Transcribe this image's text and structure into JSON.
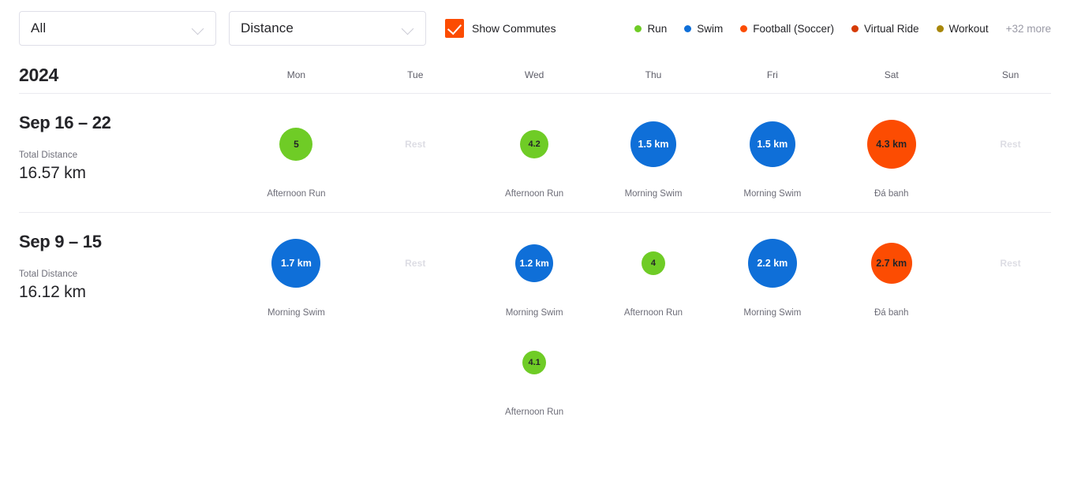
{
  "toolbar": {
    "sport_filter": {
      "value": "All",
      "chevron_icon": "chevron-down-icon"
    },
    "metric_filter": {
      "value": "Distance",
      "chevron_icon": "chevron-down-icon"
    },
    "show_commutes": {
      "label": "Show Commutes",
      "checked": true,
      "icon": "check-icon",
      "color": "#fc4c02"
    }
  },
  "legend": {
    "items": [
      {
        "label": "Run",
        "color": "#6fcc26"
      },
      {
        "label": "Swim",
        "color": "#0f6fd8"
      },
      {
        "label": "Football (Soccer)",
        "color": "#fc4c02"
      },
      {
        "label": "Virtual Ride",
        "color": "#d63b06"
      },
      {
        "label": "Workout",
        "color": "#a8870a"
      }
    ],
    "more": "+32 more"
  },
  "calendar": {
    "year": "2024",
    "weekdays": [
      "Mon",
      "Tue",
      "Wed",
      "Thu",
      "Fri",
      "Sat",
      "Sun"
    ],
    "rest_label": "Rest",
    "weeks": [
      {
        "range": "Sep 16 – 22",
        "total_label": "Total Distance",
        "total_value": "16.57 km",
        "rows": [
          [
            {
              "type": "activity",
              "value": "5",
              "name": "Afternoon Run",
              "color": "#6fcc26",
              "text_color": "#242428",
              "size": 42
            },
            {
              "type": "rest"
            },
            {
              "type": "activity",
              "value": "4.2",
              "name": "Afternoon Run",
              "color": "#6fcc26",
              "text_color": "#242428",
              "size": 36
            },
            {
              "type": "activity",
              "value": "1.5 km",
              "name": "Morning Swim",
              "color": "#0f6fd8",
              "text_color": "#ffffff",
              "size": 58
            },
            {
              "type": "activity",
              "value": "1.5 km",
              "name": "Morning Swim",
              "color": "#0f6fd8",
              "text_color": "#ffffff",
              "size": 58
            },
            {
              "type": "activity",
              "value": "4.3 km",
              "name": "Đá banh",
              "color": "#fc4c02",
              "text_color": "#242428",
              "size": 62
            },
            {
              "type": "rest"
            }
          ]
        ]
      },
      {
        "range": "Sep 9 – 15",
        "total_label": "Total Distance",
        "total_value": "16.12 km",
        "rows": [
          [
            {
              "type": "activity",
              "value": "1.7 km",
              "name": "Morning Swim",
              "color": "#0f6fd8",
              "text_color": "#ffffff",
              "size": 62
            },
            {
              "type": "rest"
            },
            {
              "type": "activity",
              "value": "1.2 km",
              "name": "Morning Swim",
              "color": "#0f6fd8",
              "text_color": "#ffffff",
              "size": 48
            },
            {
              "type": "activity",
              "value": "4",
              "name": "Afternoon Run",
              "color": "#6fcc26",
              "text_color": "#242428",
              "size": 30
            },
            {
              "type": "activity",
              "value": "2.2 km",
              "name": "Morning Swim",
              "color": "#0f6fd8",
              "text_color": "#ffffff",
              "size": 62
            },
            {
              "type": "activity",
              "value": "2.7 km",
              "name": "Đá banh",
              "color": "#fc4c02",
              "text_color": "#242428",
              "size": 52
            },
            {
              "type": "rest"
            }
          ],
          [
            {
              "type": "empty"
            },
            {
              "type": "empty"
            },
            {
              "type": "activity",
              "value": "4.1",
              "name": "Afternoon Run",
              "color": "#6fcc26",
              "text_color": "#242428",
              "size": 30
            },
            {
              "type": "empty"
            },
            {
              "type": "empty"
            },
            {
              "type": "empty"
            },
            {
              "type": "empty"
            }
          ]
        ]
      }
    ]
  }
}
